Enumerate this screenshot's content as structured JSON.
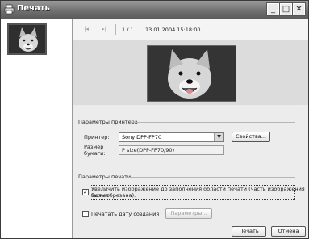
{
  "window": {
    "title": "Печать",
    "controls": {
      "minimize": "_",
      "maximize": "□",
      "close": "✕"
    }
  },
  "toolbar": {
    "first_icon": "|◂",
    "next_icon": "▸|",
    "page_counter": "1 / 1",
    "date": "13.01.2004 15:18:00"
  },
  "printer_section": {
    "heading": "Параметры принтера",
    "printer_label": "Принтер:",
    "printer_value": "Sony DPP-FP70",
    "properties_button": "Свойства...",
    "paper_label_line1": "Размер",
    "paper_label_line2": "бумаги:",
    "paper_value": "P size(DPP-FP70/90)"
  },
  "print_section": {
    "heading": "Параметры печати",
    "enlarge_checked": true,
    "enlarge_line1": "Увеличить изображение до заполнения области печати (часть изображения может",
    "enlarge_line2": "быть обрезана).",
    "date_checked": false,
    "date_label": "Печатать дату создания",
    "params_button": "Параметры..."
  },
  "footer": {
    "print_button": "Печать",
    "cancel_button": "Отмена"
  },
  "icons": {
    "window_icon": "printer-icon",
    "thumbnail": "dog-photo-thumbnail",
    "preview": "dog-photo-preview"
  }
}
